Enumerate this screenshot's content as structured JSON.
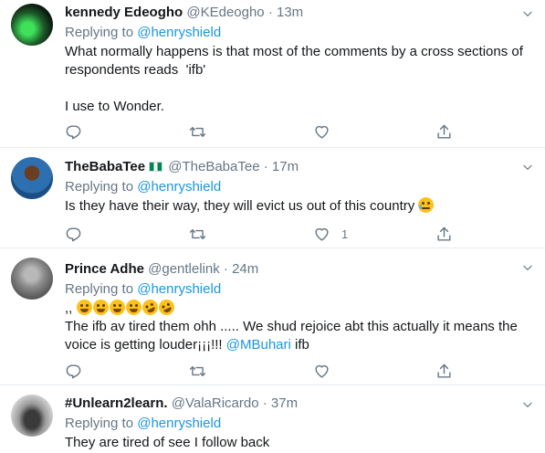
{
  "tweets": [
    {
      "name": "kennedy Edeogho",
      "handle": "@KEdeogho",
      "separator": "·",
      "time": "13m",
      "replying_prefix": "Replying to",
      "replying_to": "@henryshield",
      "text_line1": "What normally happens is that most of the comments by a cross sections of",
      "text_line2": "respondents reads  'ifb'",
      "text_line3": "I use to Wonder."
    },
    {
      "name": "TheBabaTee",
      "flag": "nigeria-flag-emoji",
      "handle": "@TheBabaTee",
      "separator": "·",
      "time": "17m",
      "replying_prefix": "Replying to",
      "replying_to": "@henryshield",
      "text_line1": "Is they have their way, they will evict us out of this country",
      "text_emoji": "disappointed-relieved-emoji",
      "like_count": "1"
    },
    {
      "name": "Prince Adhe",
      "handle": "@gentlelink",
      "separator": "·",
      "time": "24m",
      "replying_prefix": "Replying to",
      "replying_to": "@henryshield",
      "text_prefix": ",,",
      "emoji_line": [
        "joy-emoji",
        "joy-emoji",
        "joy-emoji",
        "joy-emoji",
        "rofl-emoji",
        "rofl-emoji"
      ],
      "text_line1": "The ifb av tired them ohh ..... We shud rejoice abt this actually it means the",
      "text_line2a": "voice is getting louder¡¡¡!!! ",
      "text_mention": "@MBuhari",
      "text_line2b": " ifb"
    },
    {
      "name": "#Unlearn2learn.",
      "handle": "@ValaRicardo",
      "separator": "·",
      "time": "37m",
      "replying_prefix": "Replying to",
      "replying_to": "@henryshield",
      "text_line1": "They are tired of see I follow back"
    }
  ],
  "icons": {
    "reply": "reply-icon",
    "retweet": "retweet-icon",
    "like": "heart-icon",
    "share": "share-icon",
    "more": "chevron-down-icon"
  },
  "colors": {
    "link": "#1b95e0",
    "muted": "#657786",
    "text": "#14171a",
    "divider": "#e6ecf0"
  }
}
